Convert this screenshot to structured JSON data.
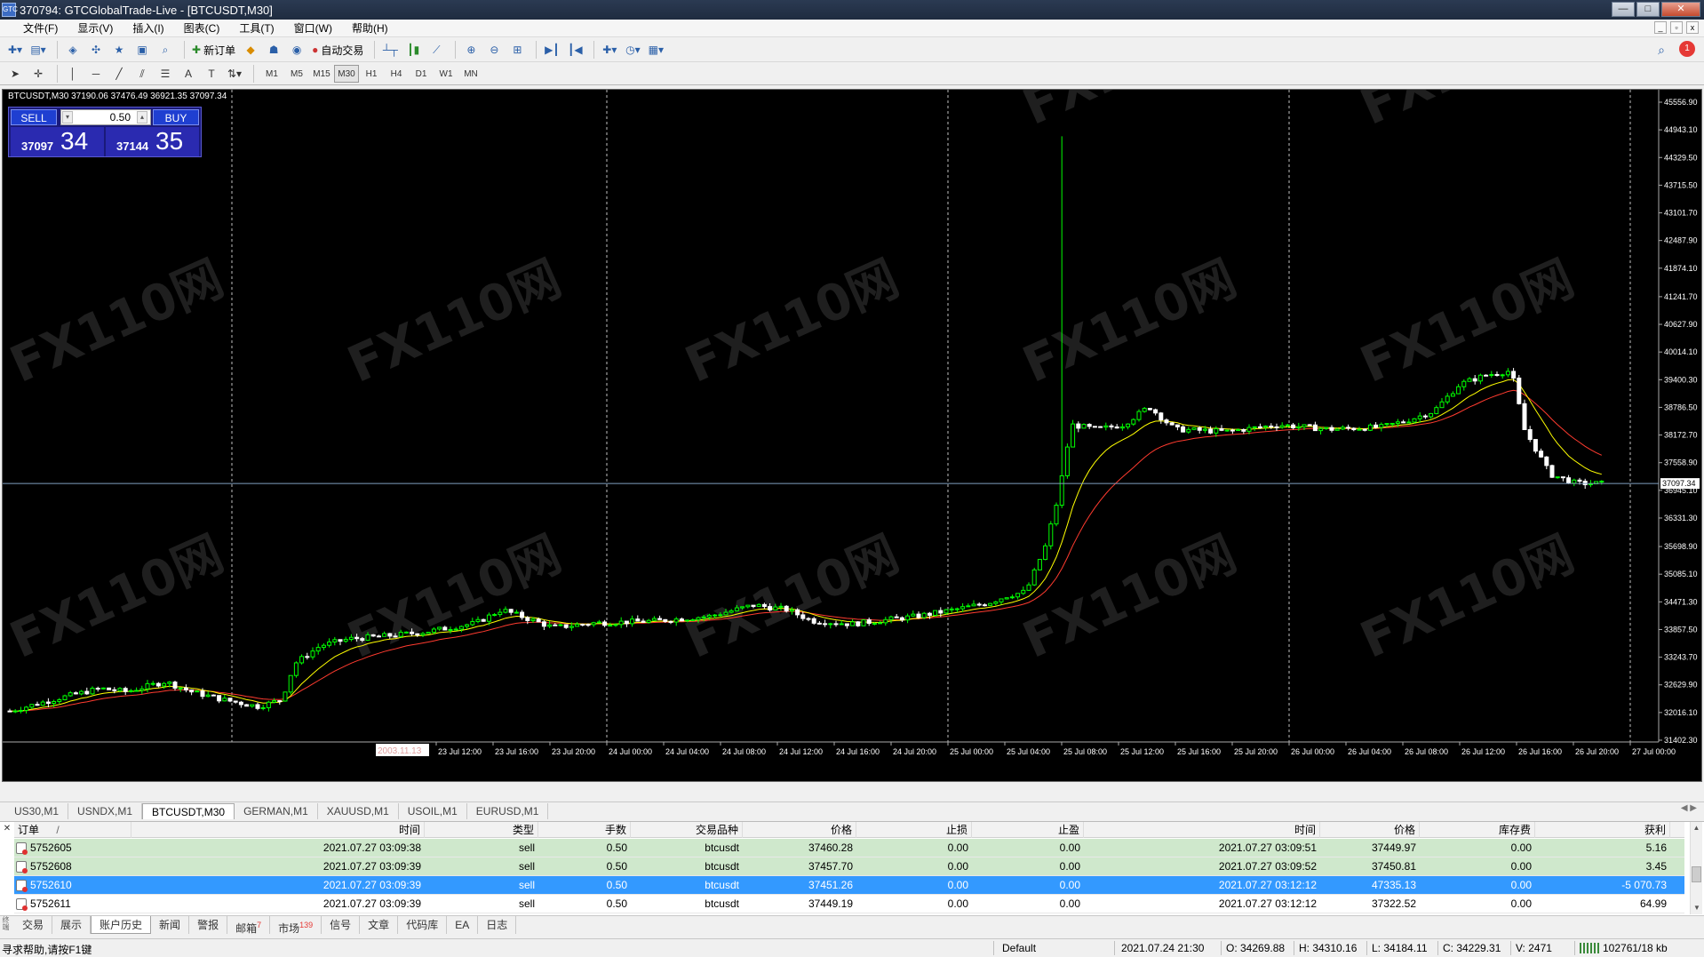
{
  "window": {
    "title": "370794: GTCGlobalTrade-Live - [BTCUSDT,M30]",
    "app_icon_text": "GTC",
    "buttons": [
      "—",
      "□",
      "✕"
    ]
  },
  "menu": {
    "items": [
      "文件(F)",
      "显示(V)",
      "插入(I)",
      "图表(C)",
      "工具(T)",
      "窗口(W)",
      "帮助(H)"
    ]
  },
  "toolbar": {
    "new_order": "新订单",
    "auto_trade": "自动交易",
    "timeframes": [
      "M1",
      "M5",
      "M15",
      "M30",
      "H1",
      "H4",
      "D1",
      "W1",
      "MN"
    ],
    "active_timeframe": "M30",
    "notification_count": "1",
    "icons": [
      "new-chart-icon",
      "profiles-icon",
      "market-watch-icon",
      "navigator-icon",
      "data-window-icon",
      "terminal-icon",
      "strategy-tester-icon"
    ]
  },
  "chart": {
    "info": "BTCUSDT,M30  37190.06 37476.49 36921.35 37097.34",
    "sell_label": "SELL",
    "buy_label": "BUY",
    "lot": "0.50",
    "sell_price_small": "37097",
    "sell_price_big": "34",
    "buy_price_small": "37144",
    "buy_price_big": "35",
    "current_price_label": "37097.34",
    "watermark": "FX110网",
    "left_date_label": "2003.11.13",
    "y_ticks": [
      "45556.90",
      "44943.10",
      "44329.50",
      "43715.50",
      "43101.70",
      "42487.90",
      "41874.10",
      "41241.70",
      "40627.90",
      "40014.10",
      "39400.30",
      "38786.50",
      "38172.70",
      "37558.90",
      "36945.10",
      "36331.30",
      "35698.90",
      "35085.10",
      "34471.30",
      "33857.50",
      "33243.70",
      "32629.90",
      "32016.10",
      "31402.30"
    ],
    "x_ticks": [
      "23 Jul 12:00",
      "23 Jul 16:00",
      "23 Jul 20:00",
      "24 Jul 00:00",
      "24 Jul 04:00",
      "24 Jul 08:00",
      "24 Jul 12:00",
      "24 Jul 16:00",
      "24 Jul 20:00",
      "25 Jul 00:00",
      "25 Jul 04:00",
      "25 Jul 08:00",
      "25 Jul 12:00",
      "25 Jul 16:00",
      "25 Jul 20:00",
      "26 Jul 00:00",
      "26 Jul 04:00",
      "26 Jul 08:00",
      "26 Jul 12:00",
      "26 Jul 16:00",
      "26 Jul 20:00",
      "27 Jul 00:00"
    ],
    "colors": {
      "bull": "#00ff00",
      "bear": "#ffffff",
      "ma_fast": "#ffff00",
      "ma_slow": "#ff3b2f",
      "grid": "#c0c0c0",
      "bid_line": "#7f9fbf"
    }
  },
  "symbol_tabs": [
    "US30,M1",
    "USNDX,M1",
    "BTCUSDT,M30",
    "GERMAN,M1",
    "XAUUSD,M1",
    "USOIL,M1",
    "EURUSD,M1"
  ],
  "symbol_tab_active": "BTCUSDT,M30",
  "terminal": {
    "columns": [
      "订单",
      "时间",
      "类型",
      "手数",
      "交易品种",
      "价格",
      "止损",
      "止盈",
      "时间",
      "价格",
      "库存费",
      "获利"
    ],
    "sort_marker": "/",
    "rows": [
      {
        "order": "5752605",
        "open_time": "2021.07.27 03:09:38",
        "type": "sell",
        "lots": "0.50",
        "symbol": "btcusdt",
        "open_price": "37460.28",
        "sl": "0.00",
        "tp": "0.00",
        "close_time": "2021.07.27 03:09:51",
        "close_price": "37449.97",
        "swap": "0.00",
        "profit": "5.16"
      },
      {
        "order": "5752608",
        "open_time": "2021.07.27 03:09:39",
        "type": "sell",
        "lots": "0.50",
        "symbol": "btcusdt",
        "open_price": "37457.70",
        "sl": "0.00",
        "tp": "0.00",
        "close_time": "2021.07.27 03:09:52",
        "close_price": "37450.81",
        "swap": "0.00",
        "profit": "3.45"
      },
      {
        "order": "5752610",
        "open_time": "2021.07.27 03:09:39",
        "type": "sell",
        "lots": "0.50",
        "symbol": "btcusdt",
        "open_price": "37451.26",
        "sl": "0.00",
        "tp": "0.00",
        "close_time": "2021.07.27 03:12:12",
        "close_price": "47335.13",
        "swap": "0.00",
        "profit": "-5 070.73"
      },
      {
        "order": "5752611",
        "open_time": "2021.07.27 03:09:39",
        "type": "sell",
        "lots": "0.50",
        "symbol": "btcusdt",
        "open_price": "37449.19",
        "sl": "0.00",
        "tp": "0.00",
        "close_time": "2021.07.27 03:12:12",
        "close_price": "37322.52",
        "swap": "0.00",
        "profit": "64.99"
      }
    ]
  },
  "terminal_tabs": [
    {
      "label": "交易",
      "badge": ""
    },
    {
      "label": "展示",
      "badge": ""
    },
    {
      "label": "账户历史",
      "badge": ""
    },
    {
      "label": "新闻",
      "badge": ""
    },
    {
      "label": "警报",
      "badge": ""
    },
    {
      "label": "邮箱",
      "badge": "7"
    },
    {
      "label": "市场",
      "badge": "139"
    },
    {
      "label": "信号",
      "badge": ""
    },
    {
      "label": "文章",
      "badge": ""
    },
    {
      "label": "代码库",
      "badge": ""
    },
    {
      "label": "EA",
      "badge": ""
    },
    {
      "label": "日志",
      "badge": ""
    }
  ],
  "terminal_tab_active": "账户历史",
  "terminal_side_label": "终端",
  "status": {
    "help": "寻求帮助,请按F1键",
    "profile": "Default",
    "datetime": "2021.07.24 21:30",
    "open": "O: 34269.88",
    "high": "H: 34310.16",
    "low": "L: 34184.11",
    "close": "C: 34229.31",
    "volume": "V: 2471",
    "traffic": "102761/18 kb"
  }
}
